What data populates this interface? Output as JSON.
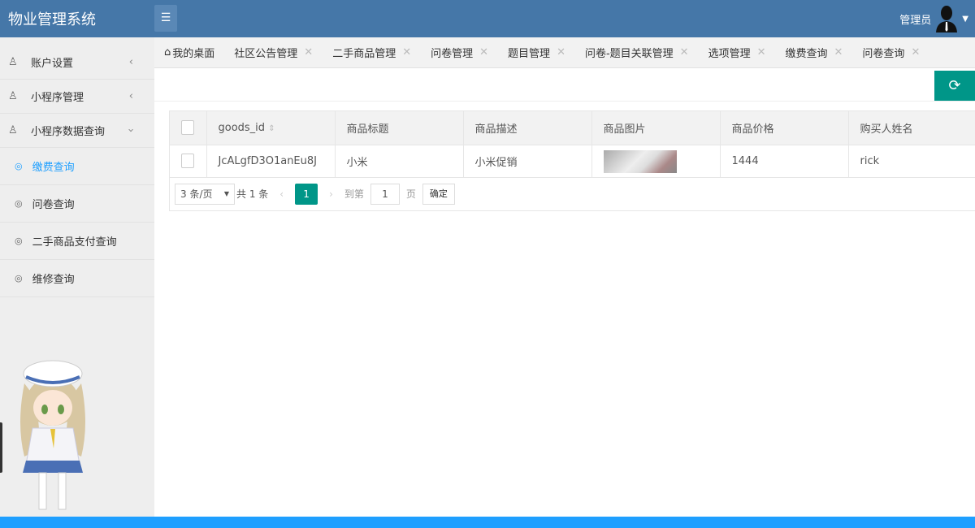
{
  "header": {
    "title": "物业管理系统",
    "user": "管理员"
  },
  "sidebar": {
    "items": [
      {
        "label": "账户设置"
      },
      {
        "label": "小程序管理"
      },
      {
        "label": "小程序数据查询"
      }
    ],
    "subitems": [
      {
        "label": "缴费查询"
      },
      {
        "label": "问卷查询"
      },
      {
        "label": "二手商品支付查询"
      },
      {
        "label": "维修查询"
      }
    ]
  },
  "tabs": [
    {
      "label": "我的桌面"
    },
    {
      "label": "社区公告管理"
    },
    {
      "label": "二手商品管理"
    },
    {
      "label": "问卷管理"
    },
    {
      "label": "题目管理"
    },
    {
      "label": "问卷-题目关联管理"
    },
    {
      "label": "选项管理"
    },
    {
      "label": "缴费查询"
    },
    {
      "label": "问卷查询"
    }
  ],
  "table": {
    "columns": [
      "goods_id",
      "商品标题",
      "商品描述",
      "商品图片",
      "商品价格",
      "购买人姓名"
    ],
    "rows": [
      {
        "goods_id": "JcALgfD3O1anEu8J",
        "title": "小米",
        "desc": "小米促销",
        "price": "1444",
        "buyer": "rick"
      }
    ]
  },
  "pager": {
    "page_size": "3 条/页",
    "total": "共 1 条",
    "current": "1",
    "goto_label": "到第",
    "goto_value": "1",
    "page_unit": "页",
    "confirm": "确定"
  }
}
